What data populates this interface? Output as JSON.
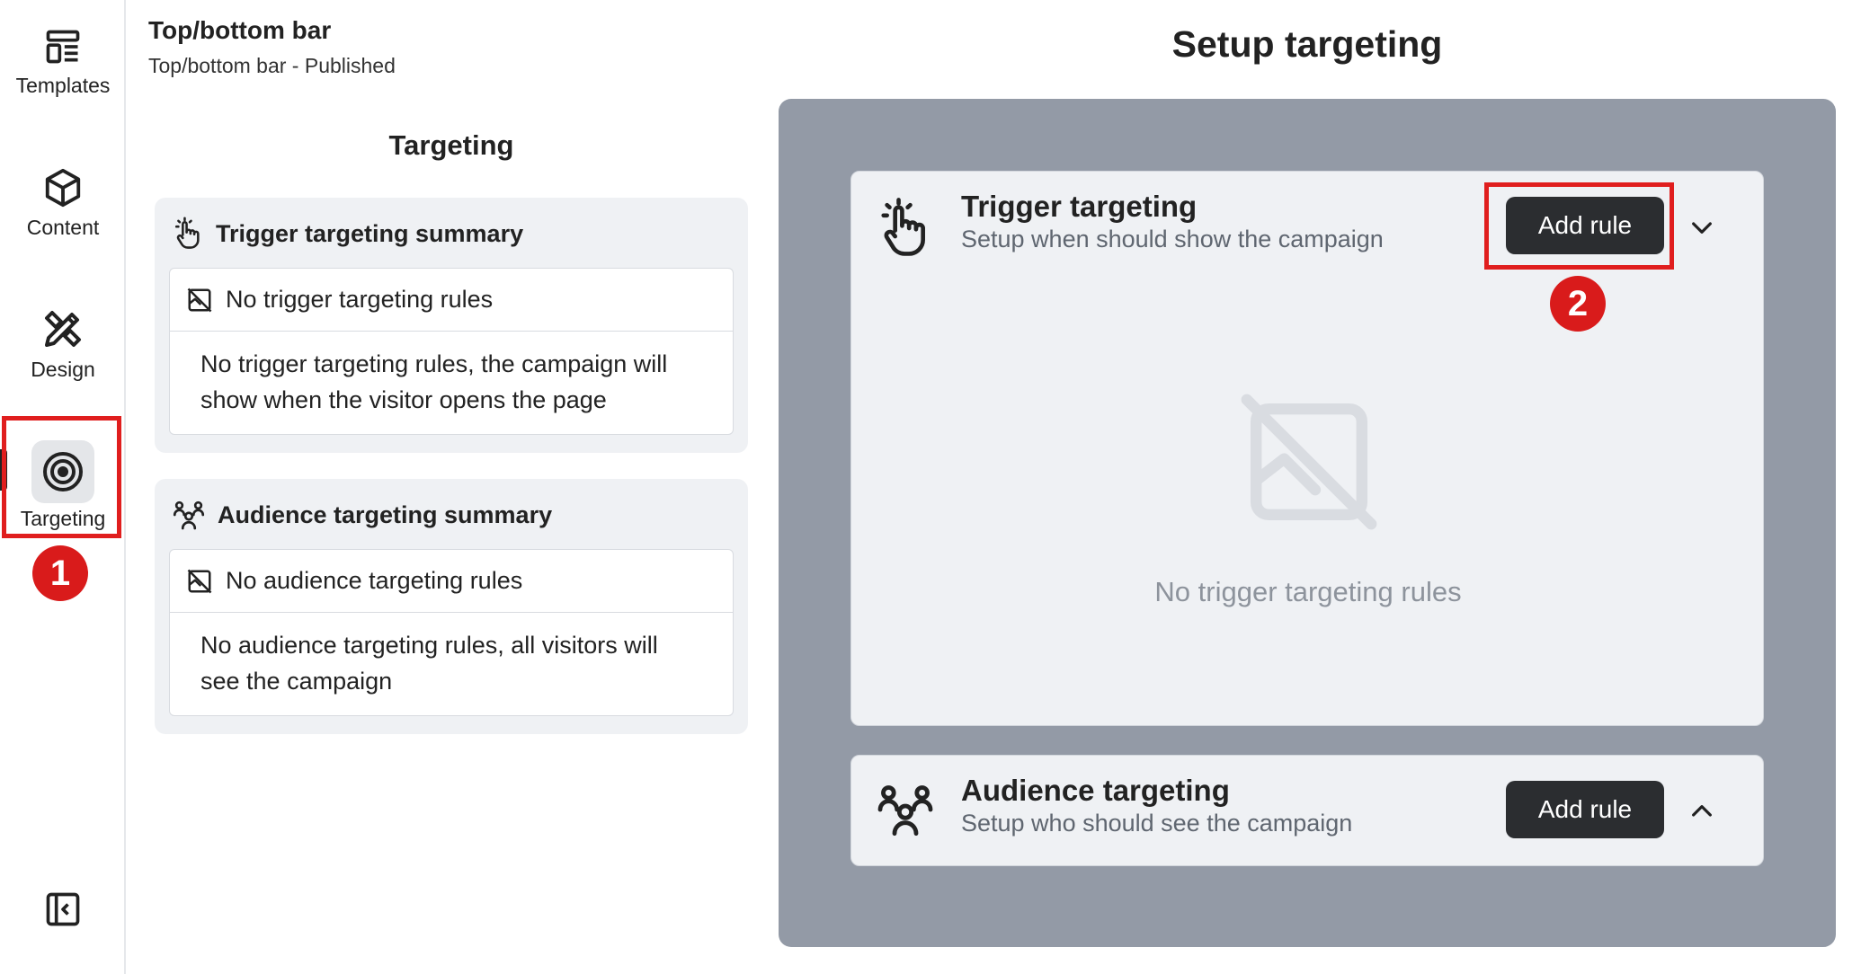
{
  "rail": {
    "items": [
      {
        "label": "Templates",
        "icon": "templates-icon"
      },
      {
        "label": "Content",
        "icon": "cube-icon"
      },
      {
        "label": "Design",
        "icon": "design-tools-icon"
      },
      {
        "label": "Targeting",
        "icon": "target-icon",
        "active": true
      }
    ],
    "collapse_icon": "collapse-sidebar-icon"
  },
  "header": {
    "title": "Top/bottom bar",
    "subtitle": "Top/bottom bar - Published"
  },
  "summary": {
    "title": "Targeting",
    "trigger": {
      "heading": "Trigger targeting summary",
      "empty_label": "No trigger targeting rules",
      "description": "No trigger targeting rules, the campaign will show when the visitor opens the page"
    },
    "audience": {
      "heading": "Audience targeting summary",
      "empty_label": "No audience targeting rules",
      "description": "No audience targeting rules, all visitors will see the campaign"
    }
  },
  "setup": {
    "title": "Setup targeting",
    "trigger": {
      "title": "Trigger targeting",
      "subtitle": "Setup when should show the campaign",
      "button": "Add rule",
      "empty_text": "No trigger targeting rules"
    },
    "audience": {
      "title": "Audience targeting",
      "subtitle": "Setup who should see the campaign",
      "button": "Add rule"
    }
  },
  "annotations": {
    "step1": "1",
    "step2": "2",
    "highlight_color": "#e01e1e"
  }
}
